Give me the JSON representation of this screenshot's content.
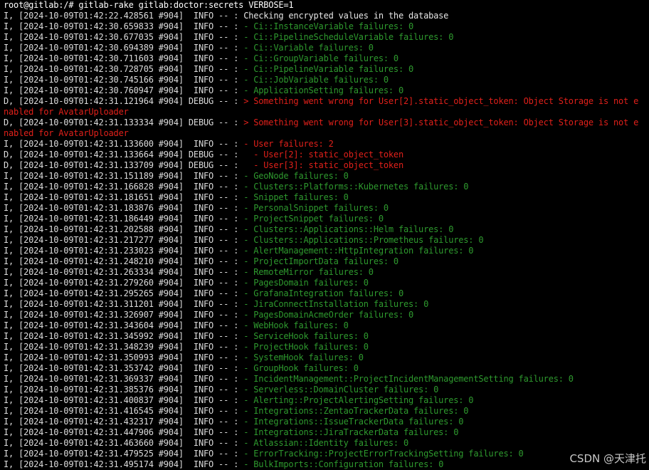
{
  "terminal": {
    "lines": [
      {
        "meta": "root@gitlab:/# gitlab-rake gitlab:doctor:secrets VERBOSE=1",
        "msg": "",
        "color": "white",
        "kind": "prompt"
      },
      {
        "meta": "I, [2024-10-09T01:42:22.428561 #904]  INFO -- : ",
        "msg": "Checking encrypted values in the database",
        "color": "white"
      },
      {
        "meta": "I, [2024-10-09T01:42:30.659833 #904]  INFO -- : ",
        "msg": "- Ci::InstanceVariable failures: 0",
        "color": "green"
      },
      {
        "meta": "I, [2024-10-09T01:42:30.677035 #904]  INFO -- : ",
        "msg": "- Ci::PipelineScheduleVariable failures: 0",
        "color": "green"
      },
      {
        "meta": "I, [2024-10-09T01:42:30.694389 #904]  INFO -- : ",
        "msg": "- Ci::Variable failures: 0",
        "color": "green"
      },
      {
        "meta": "I, [2024-10-09T01:42:30.711603 #904]  INFO -- : ",
        "msg": "- Ci::GroupVariable failures: 0",
        "color": "green"
      },
      {
        "meta": "I, [2024-10-09T01:42:30.728705 #904]  INFO -- : ",
        "msg": "- Ci::PipelineVariable failures: 0",
        "color": "green"
      },
      {
        "meta": "I, [2024-10-09T01:42:30.745166 #904]  INFO -- : ",
        "msg": "- Ci::JobVariable failures: 0",
        "color": "green"
      },
      {
        "meta": "I, [2024-10-09T01:42:30.760947 #904]  INFO -- : ",
        "msg": "- ApplicationSetting failures: 0",
        "color": "green"
      },
      {
        "meta": "D, [2024-10-09T01:42:31.121964 #904] DEBUG -- : ",
        "msg": "> Something went wrong for User[2].static_object_token: Object Storage is not e",
        "color": "red"
      },
      {
        "meta": "",
        "msg": "nabled for AvatarUploader",
        "color": "red"
      },
      {
        "meta": "D, [2024-10-09T01:42:31.133334 #904] DEBUG -- : ",
        "msg": "> Something went wrong for User[3].static_object_token: Object Storage is not e",
        "color": "red"
      },
      {
        "meta": "",
        "msg": "nabled for AvatarUploader",
        "color": "red"
      },
      {
        "meta": "I, [2024-10-09T01:42:31.133600 #904]  INFO -- : ",
        "msg": "- User failures: 2",
        "color": "red"
      },
      {
        "meta": "D, [2024-10-09T01:42:31.133664 #904] DEBUG -- : ",
        "msg": "  - User[2]: static_object_token",
        "color": "red"
      },
      {
        "meta": "D, [2024-10-09T01:42:31.133709 #904] DEBUG -- : ",
        "msg": "  - User[3]: static_object_token",
        "color": "red"
      },
      {
        "meta": "I, [2024-10-09T01:42:31.151189 #904]  INFO -- : ",
        "msg": "- GeoNode failures: 0",
        "color": "green"
      },
      {
        "meta": "I, [2024-10-09T01:42:31.166828 #904]  INFO -- : ",
        "msg": "- Clusters::Platforms::Kubernetes failures: 0",
        "color": "green"
      },
      {
        "meta": "I, [2024-10-09T01:42:31.181651 #904]  INFO -- : ",
        "msg": "- Snippet failures: 0",
        "color": "green"
      },
      {
        "meta": "I, [2024-10-09T01:42:31.183876 #904]  INFO -- : ",
        "msg": "- PersonalSnippet failures: 0",
        "color": "green"
      },
      {
        "meta": "I, [2024-10-09T01:42:31.186449 #904]  INFO -- : ",
        "msg": "- ProjectSnippet failures: 0",
        "color": "green"
      },
      {
        "meta": "I, [2024-10-09T01:42:31.202588 #904]  INFO -- : ",
        "msg": "- Clusters::Applications::Helm failures: 0",
        "color": "green"
      },
      {
        "meta": "I, [2024-10-09T01:42:31.217277 #904]  INFO -- : ",
        "msg": "- Clusters::Applications::Prometheus failures: 0",
        "color": "green"
      },
      {
        "meta": "I, [2024-10-09T01:42:31.233023 #904]  INFO -- : ",
        "msg": "- AlertManagement::HttpIntegration failures: 0",
        "color": "green"
      },
      {
        "meta": "I, [2024-10-09T01:42:31.248210 #904]  INFO -- : ",
        "msg": "- ProjectImportData failures: 0",
        "color": "green"
      },
      {
        "meta": "I, [2024-10-09T01:42:31.263334 #904]  INFO -- : ",
        "msg": "- RemoteMirror failures: 0",
        "color": "green"
      },
      {
        "meta": "I, [2024-10-09T01:42:31.279260 #904]  INFO -- : ",
        "msg": "- PagesDomain failures: 0",
        "color": "green"
      },
      {
        "meta": "I, [2024-10-09T01:42:31.295265 #904]  INFO -- : ",
        "msg": "- GrafanaIntegration failures: 0",
        "color": "green"
      },
      {
        "meta": "I, [2024-10-09T01:42:31.311201 #904]  INFO -- : ",
        "msg": "- JiraConnectInstallation failures: 0",
        "color": "green"
      },
      {
        "meta": "I, [2024-10-09T01:42:31.326907 #904]  INFO -- : ",
        "msg": "- PagesDomainAcmeOrder failures: 0",
        "color": "green"
      },
      {
        "meta": "I, [2024-10-09T01:42:31.343604 #904]  INFO -- : ",
        "msg": "- WebHook failures: 0",
        "color": "green"
      },
      {
        "meta": "I, [2024-10-09T01:42:31.345992 #904]  INFO -- : ",
        "msg": "- ServiceHook failures: 0",
        "color": "green"
      },
      {
        "meta": "I, [2024-10-09T01:42:31.348239 #904]  INFO -- : ",
        "msg": "- ProjectHook failures: 0",
        "color": "green"
      },
      {
        "meta": "I, [2024-10-09T01:42:31.350993 #904]  INFO -- : ",
        "msg": "- SystemHook failures: 0",
        "color": "green"
      },
      {
        "meta": "I, [2024-10-09T01:42:31.353742 #904]  INFO -- : ",
        "msg": "- GroupHook failures: 0",
        "color": "green"
      },
      {
        "meta": "I, [2024-10-09T01:42:31.369337 #904]  INFO -- : ",
        "msg": "- IncidentManagement::ProjectIncidentManagementSetting failures: 0",
        "color": "green"
      },
      {
        "meta": "I, [2024-10-09T01:42:31.385376 #904]  INFO -- : ",
        "msg": "- Serverless::DomainCluster failures: 0",
        "color": "green"
      },
      {
        "meta": "I, [2024-10-09T01:42:31.400837 #904]  INFO -- : ",
        "msg": "- Alerting::ProjectAlertingSetting failures: 0",
        "color": "green"
      },
      {
        "meta": "I, [2024-10-09T01:42:31.416545 #904]  INFO -- : ",
        "msg": "- Integrations::ZentaoTrackerData failures: 0",
        "color": "green"
      },
      {
        "meta": "I, [2024-10-09T01:42:31.432317 #904]  INFO -- : ",
        "msg": "- Integrations::IssueTrackerData failures: 0",
        "color": "green"
      },
      {
        "meta": "I, [2024-10-09T01:42:31.447906 #904]  INFO -- : ",
        "msg": "- Integrations::JiraTrackerData failures: 0",
        "color": "green"
      },
      {
        "meta": "I, [2024-10-09T01:42:31.463660 #904]  INFO -- : ",
        "msg": "- Atlassian::Identity failures: 0",
        "color": "green"
      },
      {
        "meta": "I, [2024-10-09T01:42:31.479525 #904]  INFO -- : ",
        "msg": "- ErrorTracking::ProjectErrorTrackingSetting failures: 0",
        "color": "green"
      },
      {
        "meta": "I, [2024-10-09T01:42:31.495174 #904]  INFO -- : ",
        "msg": "- BulkImports::Configuration failures: 0",
        "color": "green"
      }
    ]
  },
  "watermark": "CSDN @天津托",
  "colors": {
    "background": "#000000",
    "green": "#2e9a2e",
    "red": "#e0201a",
    "text": "#dcdcdc"
  }
}
